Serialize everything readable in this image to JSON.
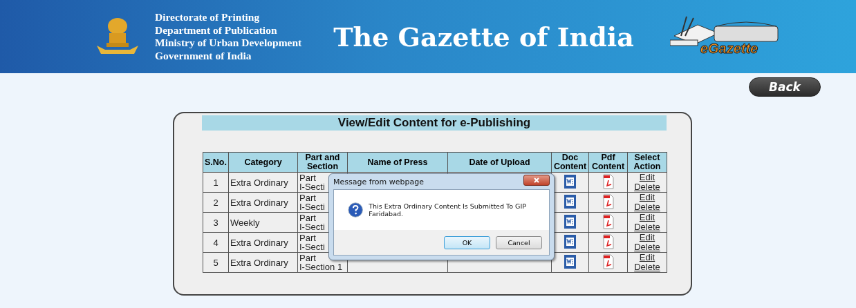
{
  "header": {
    "org_lines": [
      "Directorate of Printing",
      "Department of Publication",
      "Ministry of Urban Development",
      "Government of India"
    ],
    "title": "The Gazette of India",
    "logo_text": "eGazette"
  },
  "back_button": "Back",
  "panel": {
    "title": "View/Edit Content for e-Publishing"
  },
  "table": {
    "columns": [
      "S.No.",
      "Category",
      "Part and Section",
      "Name of Press",
      "Date of Upload",
      "Doc Content",
      "Pdf Content",
      "Select Action"
    ],
    "rows": [
      {
        "sno": "1",
        "category": "Extra Ordinary",
        "part": [
          "Part",
          "I-Secti"
        ],
        "edit": "Edit",
        "delete": "Delete"
      },
      {
        "sno": "2",
        "category": "Extra Ordinary",
        "part": [
          "Part",
          "I-Secti"
        ],
        "edit": "Edit",
        "delete": "Delete"
      },
      {
        "sno": "3",
        "category": "Weekly",
        "part": [
          "Part",
          "I-Secti"
        ],
        "edit": "Edit",
        "delete": "Delete"
      },
      {
        "sno": "4",
        "category": "Extra Ordinary",
        "part": [
          "Part",
          "I-Secti"
        ],
        "edit": "Edit",
        "delete": "Delete"
      },
      {
        "sno": "5",
        "category": "Extra Ordinary",
        "part": [
          "Part",
          "I-Section 1"
        ],
        "edit": "Edit",
        "delete": "Delete"
      }
    ]
  },
  "dialog": {
    "title": "Message from webpage",
    "message": "This Extra Ordinary Content Is Submitted To GIP Faridabad.",
    "buttons": [
      {
        "label": "OK",
        "selected": true
      },
      {
        "label": "Cancel",
        "selected": false
      }
    ]
  }
}
